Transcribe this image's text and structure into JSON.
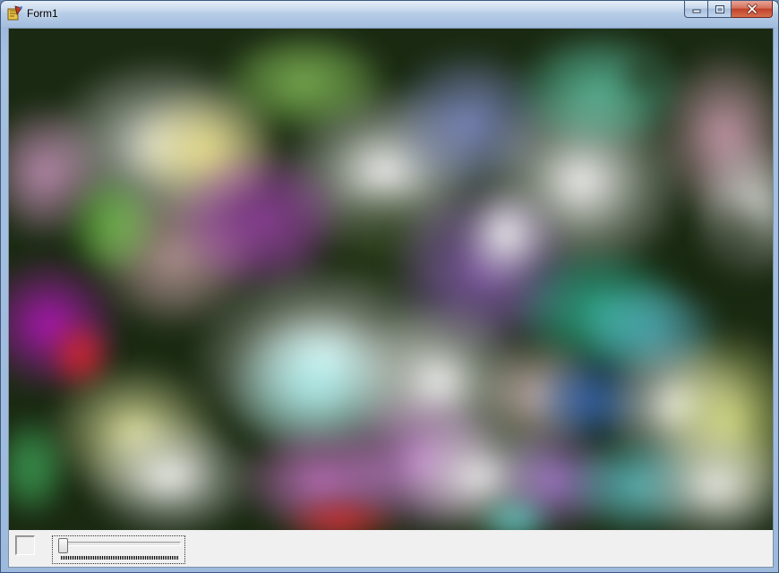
{
  "window": {
    "title": "Form1",
    "app_icon": "delphi-app-icon",
    "controls": {
      "minimize_icon": "minimize-icon",
      "maximize_icon": "maximize-icon",
      "close_icon": "close-icon"
    }
  },
  "canvas": {
    "content": "animated-plasma-blobs"
  },
  "bottom_panel": {
    "color_box": "color-swatch",
    "trackbar": {
      "value_fraction": 0.0
    }
  },
  "colors": {
    "title_bar": "#a9c3e2",
    "close_button": "#c2412a",
    "client_bg": "#f0f0f0"
  }
}
